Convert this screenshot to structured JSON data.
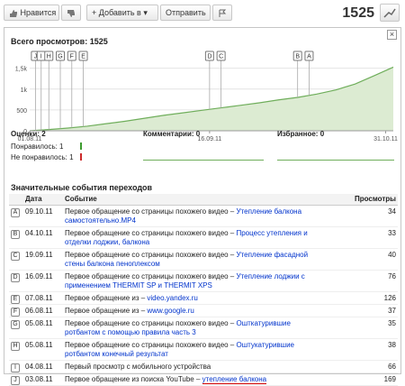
{
  "toolbar": {
    "like_label": "Нравится",
    "add_label": "Добавить в",
    "share_label": "Отправить",
    "views": "1525"
  },
  "colors": {
    "chart_fill": "#dcebd2",
    "chart_line": "#6fae5b",
    "like_bar": "#3d9b2f",
    "dislike_bar": "#cc2b2b",
    "link": "#0033cc"
  },
  "panel": {
    "views_title": "Всего просмотров: 1525",
    "close_symbol": "×",
    "ratings_title": "Оценки: 2",
    "likes": "Понравилось: 1",
    "dislikes": "Не понравилось: 1",
    "comments_title": "Комментарии: 0",
    "favorites_title": "Избранное: 0",
    "section_title": "Значительные события переходов",
    "columns": {
      "date": "Дата",
      "event": "Событие",
      "views": "Просмотры"
    }
  },
  "chart_data": {
    "type": "area",
    "x_ticks": [
      "01.08.11",
      "16.09.11",
      "31.10.11"
    ],
    "y_ticks": [
      "0",
      "500",
      "1k",
      "1,5k"
    ],
    "ylim": [
      0,
      1600
    ],
    "x_range_days": [
      0,
      95
    ],
    "series": [
      {
        "x": [
          0,
          5,
          10,
          15,
          20,
          25,
          30,
          35,
          40,
          45,
          50,
          55,
          60,
          65,
          70,
          75,
          80,
          85,
          90,
          95
        ],
        "values": [
          0,
          30,
          65,
          110,
          170,
          230,
          300,
          370,
          430,
          490,
          550,
          610,
          670,
          740,
          800,
          880,
          980,
          1120,
          1320,
          1525
        ]
      }
    ],
    "markers": [
      {
        "label": "J",
        "x": 1.5
      },
      {
        "label": "I",
        "x": 3
      },
      {
        "label": "H",
        "x": 5
      },
      {
        "label": "G",
        "x": 8
      },
      {
        "label": "F",
        "x": 11
      },
      {
        "label": "E",
        "x": 14
      },
      {
        "label": "D",
        "x": 47
      },
      {
        "label": "C",
        "x": 50
      },
      {
        "label": "B",
        "x": 70
      },
      {
        "label": "A",
        "x": 73
      }
    ]
  },
  "events": [
    {
      "marker": "A",
      "date": "09.10.11",
      "text": "Первое обращение со страницы похожего видео – ",
      "link": "Утепление балкона",
      "text2": "",
      "link2": "самостоятельно.MP4",
      "views": "34"
    },
    {
      "marker": "B",
      "date": "04.10.11",
      "text": "Первое обращение со страницы похожего видео – ",
      "link": "Процесс утепления и",
      "text2": "",
      "link2": "отделки лоджии, балкона",
      "views": "33"
    },
    {
      "marker": "C",
      "date": "19.09.11",
      "text": "Первое обращение со страницы похожего видео – ",
      "link": "Утепление фасадной",
      "text2": "",
      "link2": "стены балкона пеноплексом",
      "views": "40"
    },
    {
      "marker": "D",
      "date": "16.09.11",
      "text": "Первое обращение со страницы похожего видео – ",
      "link": "Утепление лоджии с",
      "text2": "",
      "link2": "применением THERMIT SP и THERMIT XPS",
      "views": "76"
    },
    {
      "marker": "E",
      "date": "07.08.11",
      "text": "Первое обращение из – ",
      "link": "video.yandex.ru",
      "text2": "",
      "link2": "",
      "views": "126"
    },
    {
      "marker": "F",
      "date": "06.08.11",
      "text": "Первое обращение из – ",
      "link": "www.google.ru",
      "text2": "",
      "link2": "",
      "views": "37"
    },
    {
      "marker": "G",
      "date": "05.08.11",
      "text": "Первое обращение со страницы похожего видео – ",
      "link": "Ошткатурившие",
      "text2": "",
      "link2": "ротбантом с помощью правила часть 3",
      "views": "35"
    },
    {
      "marker": "H",
      "date": "05.08.11",
      "text": "Первое обращение со страницы похожего видео – ",
      "link": "Оштукатурившие",
      "text2": "",
      "link2": "ротбантом конечный результат",
      "views": "38"
    },
    {
      "marker": "I",
      "date": "04.08.11",
      "text": "Первый просмотр с мобильного устройства",
      "link": "",
      "text2": "",
      "link2": "",
      "views": "66"
    },
    {
      "marker": "J",
      "date": "03.08.11",
      "text": "Первое обращение из поиска YouTube – ",
      "link": "утепление балкона",
      "text2": "",
      "link2": "",
      "views": "169"
    }
  ]
}
